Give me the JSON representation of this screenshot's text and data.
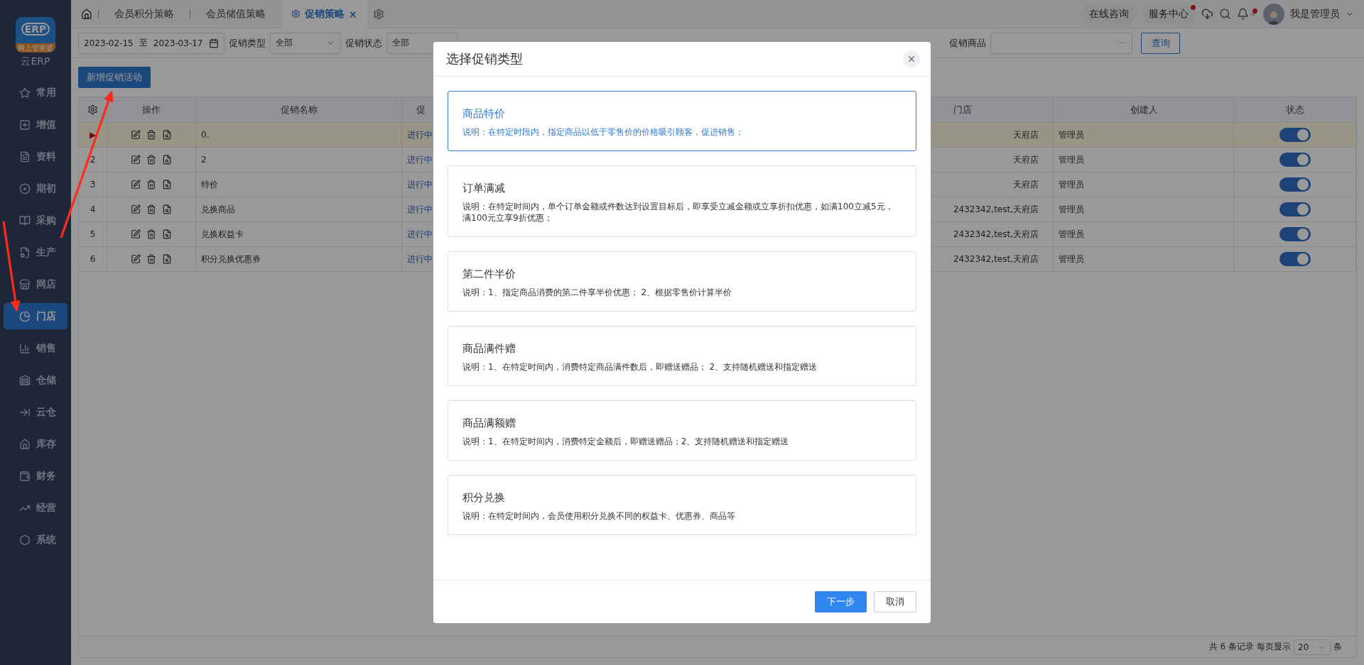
{
  "logo": {
    "mark": "ERP",
    "ribbon": "网上管家婆",
    "label": "云ERP"
  },
  "sidebar": {
    "items": [
      {
        "label": "常用",
        "selected": false
      },
      {
        "label": "增值",
        "selected": false
      },
      {
        "label": "资料",
        "selected": false
      },
      {
        "label": "期初",
        "selected": false
      },
      {
        "label": "采购",
        "selected": false
      },
      {
        "label": "生产",
        "selected": false
      },
      {
        "label": "网店",
        "selected": false
      },
      {
        "label": "门店",
        "selected": true
      },
      {
        "label": "销售",
        "selected": false
      },
      {
        "label": "仓储",
        "selected": false
      },
      {
        "label": "云仓",
        "selected": false
      },
      {
        "label": "库存",
        "selected": false
      },
      {
        "label": "财务",
        "selected": false
      },
      {
        "label": "经营",
        "selected": false
      },
      {
        "label": "系统",
        "selected": false
      }
    ]
  },
  "tabs": [
    {
      "label": "会员积分策略",
      "selected": false
    },
    {
      "label": "会员储值策略",
      "selected": false
    },
    {
      "label": "促销策略",
      "selected": true,
      "close": "×"
    }
  ],
  "header": {
    "consult": "在线咨询",
    "service": "服务中心",
    "service_dot": true,
    "bell_dot": true,
    "user": "我是管理员"
  },
  "filters": {
    "date_from": "2023-02-15",
    "date_sep": "至",
    "date_to": "2023-03-17",
    "type_label": "促销类型",
    "type_value": "全部",
    "status_label": "促销状态",
    "status_value": "全部",
    "goods_label": "促销商品",
    "goods_more": "···",
    "query": "查询"
  },
  "add_button": "新增促销活动",
  "table": {
    "marker": "▶",
    "columns": [
      "操作",
      "促销名称",
      "促",
      "门店",
      "创建人",
      "状态"
    ],
    "rows": [
      {
        "selected": true,
        "name": "0.",
        "status": "进行中",
        "store": "天府店",
        "creator": "管理员",
        "on": true
      },
      {
        "index": "2",
        "selected": false,
        "name": "2",
        "status": "进行中",
        "store": "天府店",
        "creator": "管理员",
        "on": true
      },
      {
        "index": "3",
        "selected": false,
        "name": "特价",
        "status": "进行中",
        "store": "天府店",
        "creator": "管理员",
        "on": true
      },
      {
        "index": "4",
        "selected": false,
        "name": "兑换商品",
        "status": "进行中",
        "store": "2432342,test,天府店",
        "creator": "管理员",
        "on": true
      },
      {
        "index": "5",
        "selected": false,
        "name": "兑换权益卡",
        "status": "进行中",
        "store": "2432342,test,天府店",
        "creator": "管理员",
        "on": true
      },
      {
        "index": "6",
        "selected": false,
        "name": "积分兑换优惠券",
        "status": "进行中",
        "store": "2432342,test,天府店",
        "creator": "管理员",
        "on": true
      }
    ]
  },
  "pagination": {
    "total": "共 6 条记录",
    "per_page_label": "每页显示",
    "per_page": "20",
    "unit": "条"
  },
  "dialog": {
    "title": "选择促销类型",
    "options": [
      {
        "title": "商品特价",
        "description": "说明：在特定时段内，指定商品以低于零售价的价格吸引顾客，促进销售；",
        "selected": true
      },
      {
        "title": "订单满减",
        "description": "说明：在特定时间内，单个订单金额或件数达到设置目标后，即享受立减金额或立享折扣优惠，如满100立减5元，满100元立享9折优惠；",
        "selected": false
      },
      {
        "title": "第二件半价",
        "description": "说明：1、指定商品消费的第二件享半价优惠； 2、根据零售价计算半价",
        "selected": false
      },
      {
        "title": "商品满件赠",
        "description": "说明：1、在特定时间内，消费特定商品满件数后，即赠送赠品； 2、支持随机赠送和指定赠送",
        "selected": false
      },
      {
        "title": "商品满额赠",
        "description": "说明：1、在特定时间内，消费特定金额后，即赠送赠品；2、支持随机赠送和指定赠送",
        "selected": false
      },
      {
        "title": "积分兑换",
        "description": "说明：在特定时间内，会员使用积分兑换不同的权益卡、优惠券、商品等",
        "selected": false
      }
    ],
    "next": "下一步",
    "cancel": "取消"
  }
}
